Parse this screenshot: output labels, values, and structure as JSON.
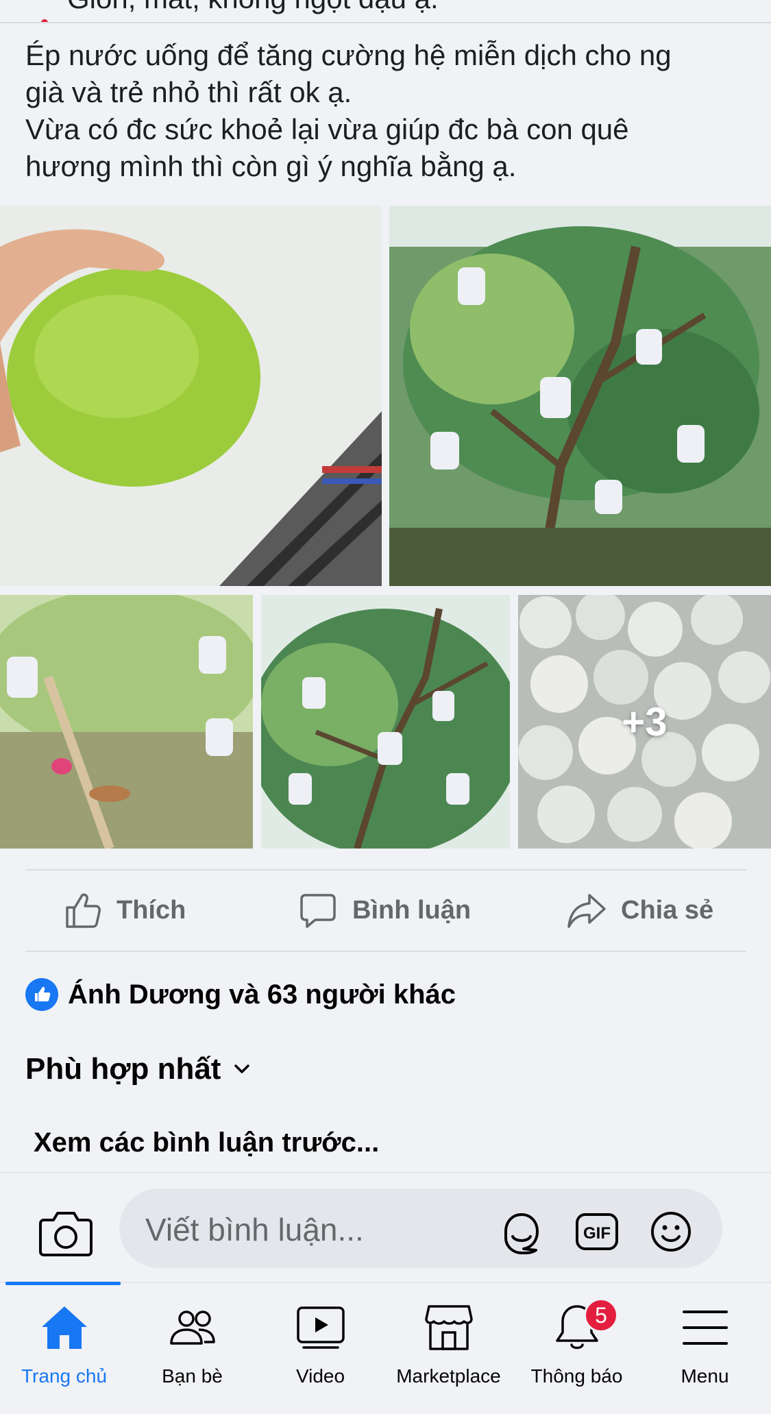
{
  "post": {
    "partial_line": "Giòn, mát, không ngọt đậu ạ.",
    "lines": [
      "Ép nước uống để tăng cường hệ miễn dịch cho ng",
      "già và trẻ nhỏ thì rất ok ạ.",
      "Vừa có đc sức khoẻ lại vừa giúp đc bà con quê",
      "hương mình thì còn gì ý nghĩa bằng ạ."
    ],
    "more_photos": "+3"
  },
  "actions": {
    "like": "Thích",
    "comment": "Bình luận",
    "share": "Chia sẻ"
  },
  "reactions": {
    "summary": "Ánh Dương và 63 người khác"
  },
  "comments": {
    "sort_label": "Phù hợp nhất",
    "view_previous": "Xem các bình luận trước...",
    "input_placeholder": "Viết bình luận..."
  },
  "tabbar": {
    "items": [
      {
        "label": "Trang chủ",
        "icon": "home-icon",
        "active": true
      },
      {
        "label": "Bạn bè",
        "icon": "friends-icon"
      },
      {
        "label": "Video",
        "icon": "video-icon"
      },
      {
        "label": "Marketplace",
        "icon": "marketplace-icon"
      },
      {
        "label": "Thông báo",
        "icon": "bell-icon",
        "badge": "5"
      },
      {
        "label": "Menu",
        "icon": "menu-icon"
      }
    ]
  },
  "colors": {
    "accent": "#1877f2",
    "badge": "#e41e3f",
    "secondary_text": "#65676b",
    "background": "#f0f2f5"
  }
}
